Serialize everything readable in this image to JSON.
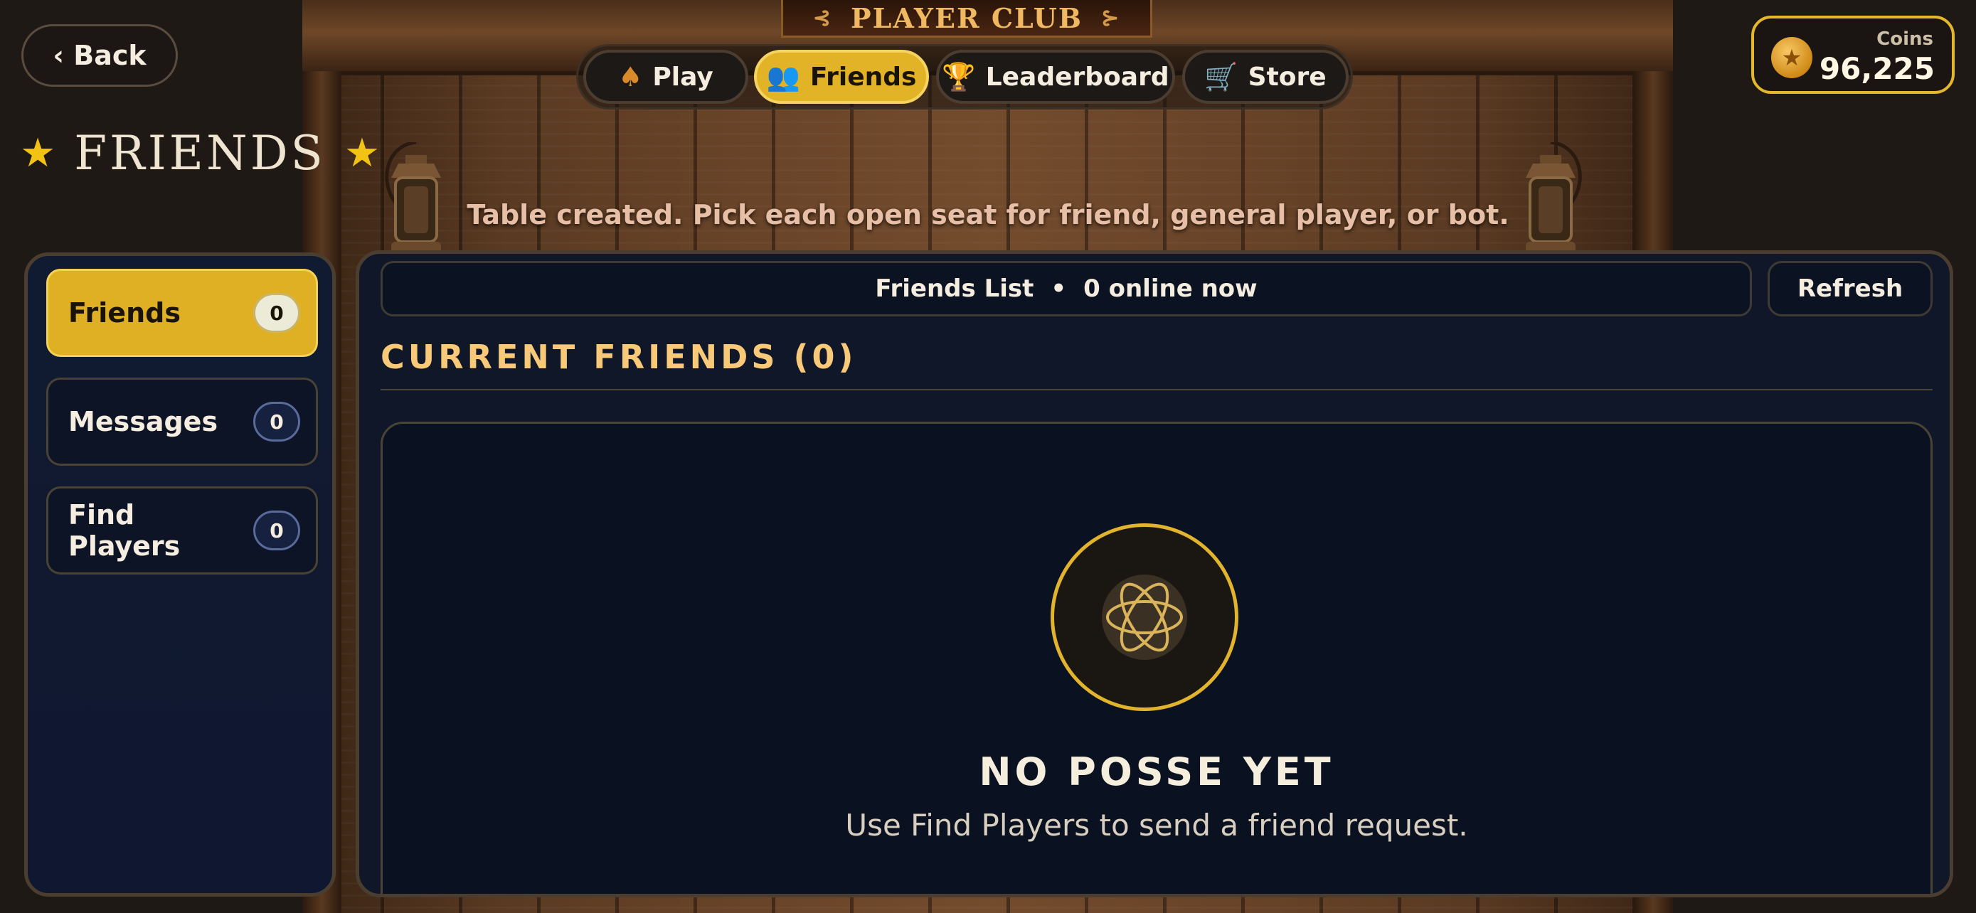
{
  "header": {
    "club_title": "PLAYER CLUB",
    "back_label": "‹ Back",
    "page_title": "FRIENDS",
    "nav": [
      {
        "label": "Play",
        "icon": "spade-icon"
      },
      {
        "label": "Friends",
        "icon": "people-icon"
      },
      {
        "label": "Leaderboard",
        "icon": "trophy-icon"
      },
      {
        "label": "Store",
        "icon": "cart-icon"
      }
    ],
    "active_nav": "Friends"
  },
  "coins": {
    "label": "Coins",
    "value": "96,225"
  },
  "status_message": "Table created. Pick each open seat for friend, general player, or bot.",
  "sidebar": {
    "items": [
      {
        "label": "Friends",
        "count": "0"
      },
      {
        "label": "Messages",
        "count": "0"
      },
      {
        "label": "Find Players",
        "count": "0"
      }
    ]
  },
  "main": {
    "list_title": "Friends List",
    "separator": "•",
    "online_text": "0 online now",
    "refresh_label": "Refresh",
    "section_title": "CURRENT FRIENDS (0)",
    "empty_title": "NO POSSE YET",
    "empty_subtitle": "Use Find Players to send a friend request."
  },
  "colors": {
    "accent_gold": "#e2b327",
    "panel_navy": "#0f1729",
    "section_gold": "#f7c979",
    "status_pink": "#e7bfa6"
  }
}
